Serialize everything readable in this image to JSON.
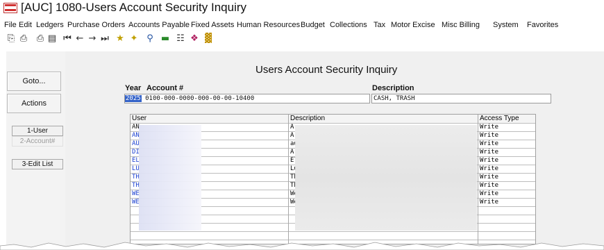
{
  "window": {
    "title": "[AUC] 1080-Users Account Security Inquiry"
  },
  "menu": [
    "File",
    "Edit",
    "Ledgers",
    "Purchase Orders",
    "Accounts Payable",
    "Fixed Assets",
    "Human Resources",
    "Budget",
    "Collections",
    "Tax",
    "Motor Excise",
    "Misc Billing",
    "System",
    "Favorites"
  ],
  "toolbar_icons": [
    "copy-icon",
    "paste-icon",
    "print-icon",
    "print-preview-icon",
    "first-record-icon",
    "previous-record-icon",
    "next-record-icon",
    "last-record-icon",
    "find-icon",
    "filter-icon",
    "search-icon",
    "spreadsheet-icon",
    "settings-icon",
    "gallery-icon",
    "report-icon"
  ],
  "sidebar": {
    "goto_label": "Goto...",
    "actions_label": "Actions",
    "btn_user": "1-User",
    "btn_account": "2-Account#",
    "btn_edit_list": "3-Edit List"
  },
  "form": {
    "page_title": "Users Account Security Inquiry",
    "year_label": "Year",
    "account_label": "Account #",
    "description_label": "Description",
    "year_value": "2025",
    "account_value": "0100-000-0000-000-00-00-10400",
    "description_value": "CASH, TRASH"
  },
  "grid": {
    "headers": {
      "user": "User",
      "description": "Description",
      "access": "Access Type"
    },
    "rows": [
      {
        "user": "AN",
        "desc": "Ar",
        "access": "Write",
        "blue": false
      },
      {
        "user": "AN",
        "desc": "Ar",
        "access": "Write",
        "blue": true
      },
      {
        "user": "AU",
        "desc": "au",
        "access": "Write",
        "blue": true
      },
      {
        "user": "DI",
        "desc": "Ar",
        "access": "Write",
        "blue": true
      },
      {
        "user": "EL",
        "desc": "El",
        "access": "Write",
        "blue": true
      },
      {
        "user": "LU",
        "desc": "Lu",
        "access": "Write",
        "blue": true
      },
      {
        "user": "TH",
        "desc": "Th",
        "access": "Write",
        "blue": true
      },
      {
        "user": "TH",
        "desc": "Th",
        "access": "Write",
        "blue": true
      },
      {
        "user": "WE",
        "desc": "We",
        "access": "Write",
        "blue": true
      },
      {
        "user": "WE",
        "desc": "We",
        "access": "Write",
        "blue": true
      }
    ]
  },
  "colors": {
    "user_text_blue": "#1a3fd0",
    "selection_blue": "#3362c8",
    "panel_gray": "#f0f0f0"
  }
}
